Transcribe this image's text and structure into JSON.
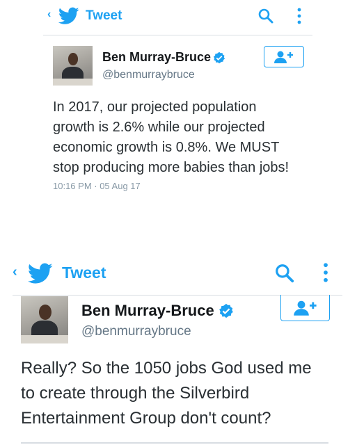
{
  "shot1": {
    "header": {
      "back_icon": "chevron-left-icon",
      "logo_icon": "twitter-bird-icon",
      "title": "Tweet",
      "search_icon": "search-icon",
      "menu_icon": "more-vertical-icon"
    },
    "author": {
      "name": "Ben Murray-Bruce",
      "handle": "@benmurraybruce",
      "verified_icon": "verified-badge-icon",
      "follow_icon": "follow-user-icon"
    },
    "tweet": {
      "lines": [
        "In 2017, our projected population",
        "growth is 2.6% while our projected",
        "economic growth is 0.8%. We MUST",
        "stop producing more babies than jobs!"
      ],
      "timestamp": "10:16 PM · 05 Aug 17"
    }
  },
  "shot2": {
    "header": {
      "back_icon": "chevron-left-icon",
      "logo_icon": "twitter-bird-icon",
      "title": "Tweet",
      "search_icon": "search-icon",
      "menu_icon": "more-vertical-icon"
    },
    "author": {
      "name": "Ben Murray-Bruce",
      "handle": "@benmurraybruce",
      "verified_icon": "verified-badge-icon",
      "follow_icon": "follow-user-icon"
    },
    "tweet": {
      "lines": [
        "Really? So the 1050 jobs God used me",
        "to create through the Silverbird",
        "Entertainment Group don't count?"
      ]
    }
  },
  "colors": {
    "accent": "#1da1f2",
    "text": "#292f33",
    "muted": "#657786",
    "divider": "#d8dde2"
  }
}
